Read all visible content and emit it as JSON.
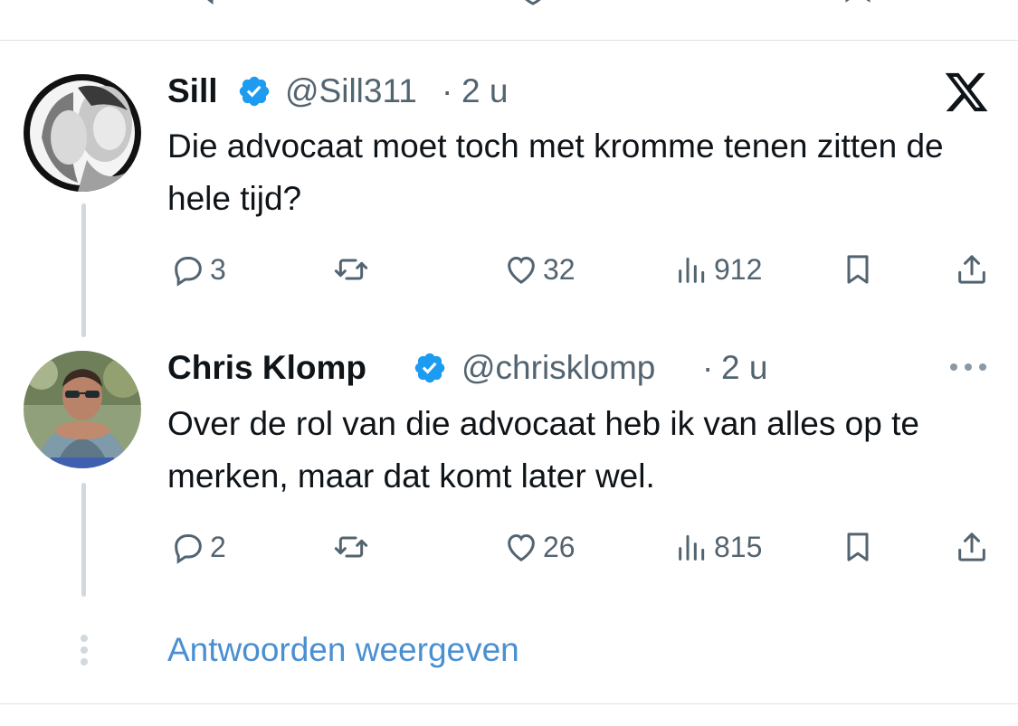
{
  "tweets": [
    {
      "name": "Sill",
      "handle": "@Sill311",
      "separator": "·",
      "time": "2 u",
      "text": "Die advocaat moet toch met kromme tenen zitten de hele tijd?",
      "replies": "3",
      "likes": "32",
      "views": "912",
      "corner_icon": "x-logo-icon",
      "verified": true
    },
    {
      "name": "Chris Klomp",
      "handle": "@chrisklomp",
      "separator": "·",
      "time": "2 u",
      "text": "Over de rol van die advocaat heb ik van alles op te merken, maar dat komt later wel.",
      "replies": "2",
      "likes": "26",
      "views": "815",
      "corner_icon": "more-icon",
      "verified": true
    }
  ],
  "show_replies_label": "Antwoorden weergeven",
  "colors": {
    "verified_badge": "#1d9bf0",
    "link": "#4a8fd2",
    "muted": "#536471",
    "thread_line": "#cfd9de"
  }
}
